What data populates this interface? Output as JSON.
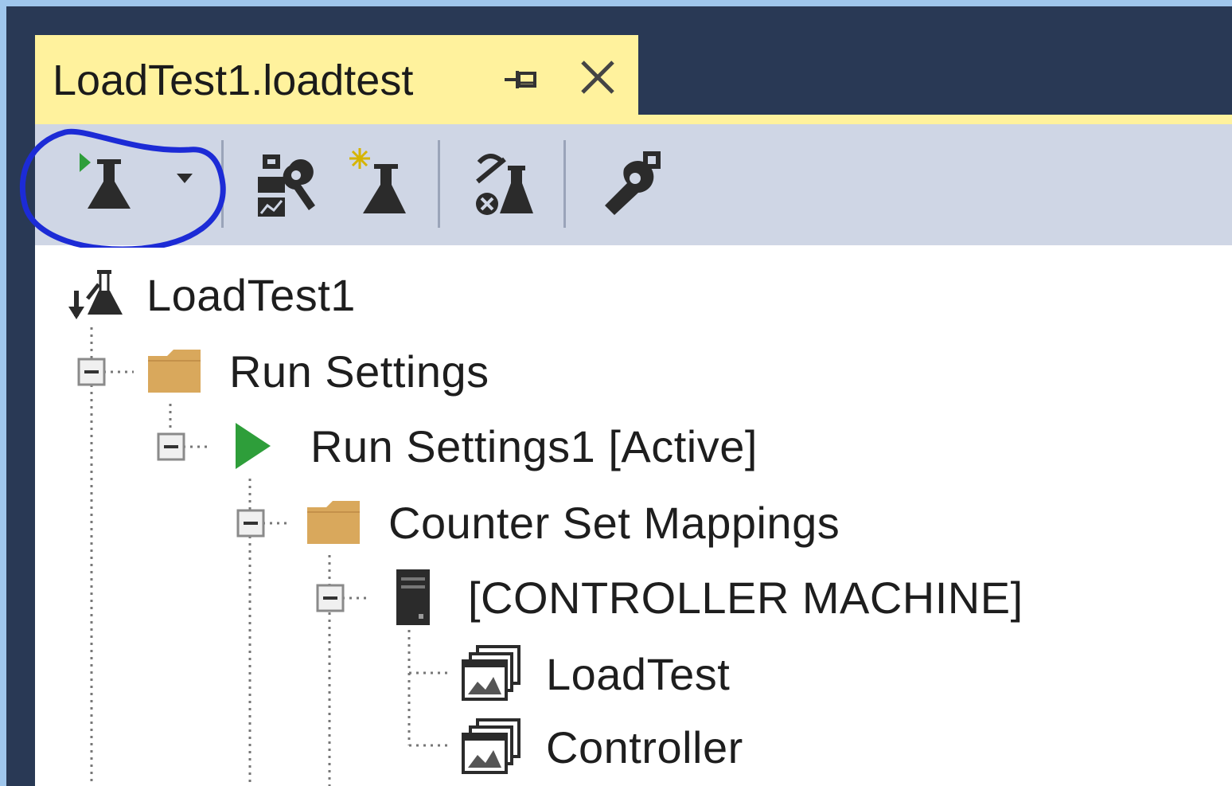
{
  "document_tab": {
    "title": "LoadTest1.loadtest",
    "pin_icon": "pin-icon",
    "close_icon": "close-icon"
  },
  "toolbar": {
    "buttons": [
      {
        "name": "run-load-test",
        "icon": "run-flask-icon",
        "has_dropdown": true,
        "highlighted": true
      },
      {
        "name": "manage-test-controllers",
        "icon": "controller-wrench-icon"
      },
      {
        "name": "add-scenario",
        "icon": "new-flask-icon"
      },
      {
        "name": "manage-counter-sets",
        "icon": "counter-set-icon"
      },
      {
        "name": "settings",
        "icon": "wrench-icon"
      }
    ],
    "highlight_color": "#1c2bd6"
  },
  "tree": {
    "root": {
      "label": "LoadTest1",
      "icon": "load-test-icon"
    },
    "nodes": [
      {
        "label": "Run Settings",
        "icon": "folder-icon"
      },
      {
        "label": "Run Settings1 [Active]",
        "icon": "play-icon"
      },
      {
        "label": "Counter Set Mappings",
        "icon": "folder-icon"
      },
      {
        "label": "[CONTROLLER MACHINE]",
        "icon": "server-icon"
      },
      {
        "label": "LoadTest",
        "icon": "counter-set-window-icon"
      },
      {
        "label": "Controller",
        "icon": "counter-set-window-icon"
      }
    ]
  },
  "colors": {
    "tab_active": "#fff29d",
    "frame_dark": "#293955",
    "toolbar_bg": "#cfd6e5",
    "folder": "#d9a85c",
    "play": "#2e9e3a"
  }
}
